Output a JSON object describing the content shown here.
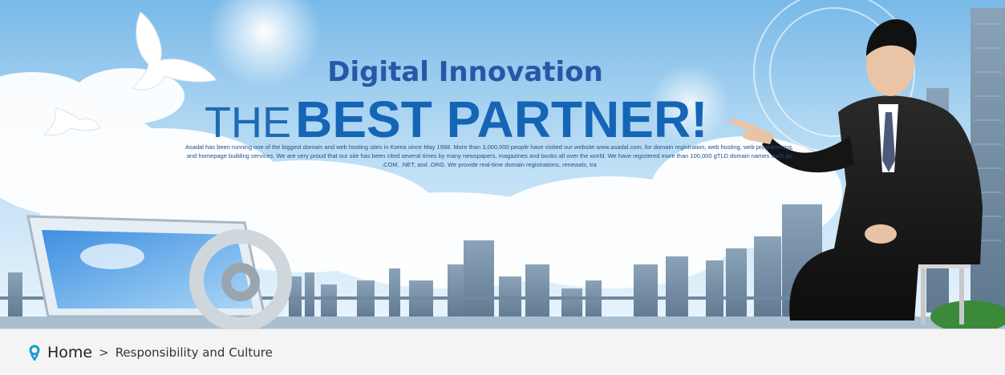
{
  "banner": {
    "subtitle": "Digital Innovation",
    "title_light": "THE",
    "title_bold": "BEST PARTNER!",
    "body_text": "Asadal has been running one of the biggest domain and web hosting sites in Korea since May 1998. More than 3,000,000 people have visited our website www.asadal.com, for domain registration, web hosting, web programming, and homepage building services. We are very proud that our site has been cited several times by many newspapers, magazines and books all over the world. We have registered more than 100,000 gTLD domain names such as .COM, .NET, and .ORG. We provide real-time domain registrations, renewals, tra"
  },
  "breadcrumb": {
    "home_label": "Home",
    "separator": ">",
    "current_label": "Responsibility and Culture"
  },
  "colors": {
    "accent": "#1b9bd1",
    "title_blue": "#1565b6",
    "bar_bg": "#f4f4f4"
  }
}
